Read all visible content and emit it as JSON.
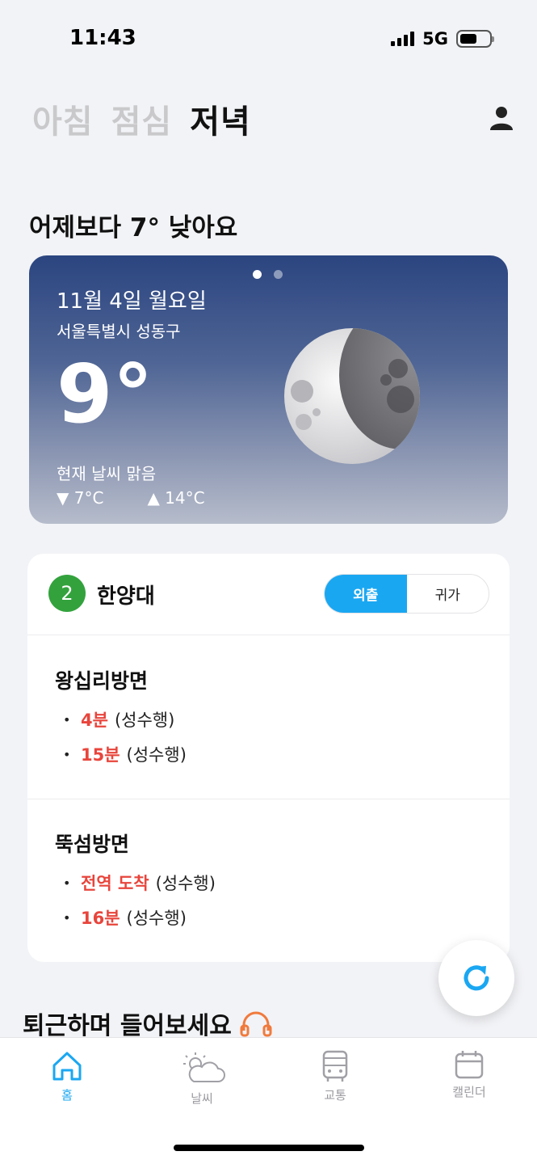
{
  "status_bar": {
    "time": "11:43",
    "network": "5G"
  },
  "meal_tabs": [
    {
      "label": "아침",
      "active": false
    },
    {
      "label": "점심",
      "active": false
    },
    {
      "label": "저녁",
      "active": true
    }
  ],
  "headline": "어제보다 7° 낮아요",
  "weather": {
    "date": "11월 4일 월요일",
    "location": "서울특별시 성동구",
    "temperature": "9°",
    "condition": "현재 날씨 맑음",
    "low": "▼ 7°C",
    "high": "▲ 14°C",
    "page_count": 2,
    "active_page": 1,
    "icon": "moon-crescent-icon"
  },
  "subway": {
    "line_number": "2",
    "line_color": "#33a23d",
    "station": "한양대",
    "toggle": {
      "options": [
        "외출",
        "귀가"
      ],
      "selected": "외출"
    },
    "directions": [
      {
        "title": "왕십리방면",
        "arrivals": [
          {
            "time": "4분",
            "destination": "(성수행)"
          },
          {
            "time": "15분",
            "destination": "(성수행)"
          }
        ]
      },
      {
        "title": "뚝섬방면",
        "arrivals": [
          {
            "time": "전역 도착",
            "destination": "(성수행)"
          },
          {
            "time": "16분",
            "destination": "(성수행)"
          }
        ]
      }
    ]
  },
  "listen_section": {
    "title": "퇴근하며 들어보세요"
  },
  "tab_bar": {
    "items": [
      {
        "label": "홈",
        "icon": "home-icon",
        "active": true
      },
      {
        "label": "날씨",
        "icon": "weather-icon",
        "active": false
      },
      {
        "label": "교통",
        "icon": "bus-icon",
        "active": false
      },
      {
        "label": "캘린더",
        "icon": "calendar-icon",
        "active": false
      }
    ]
  },
  "colors": {
    "accent": "#1aa7f2",
    "arrival_red": "#e8453c"
  }
}
